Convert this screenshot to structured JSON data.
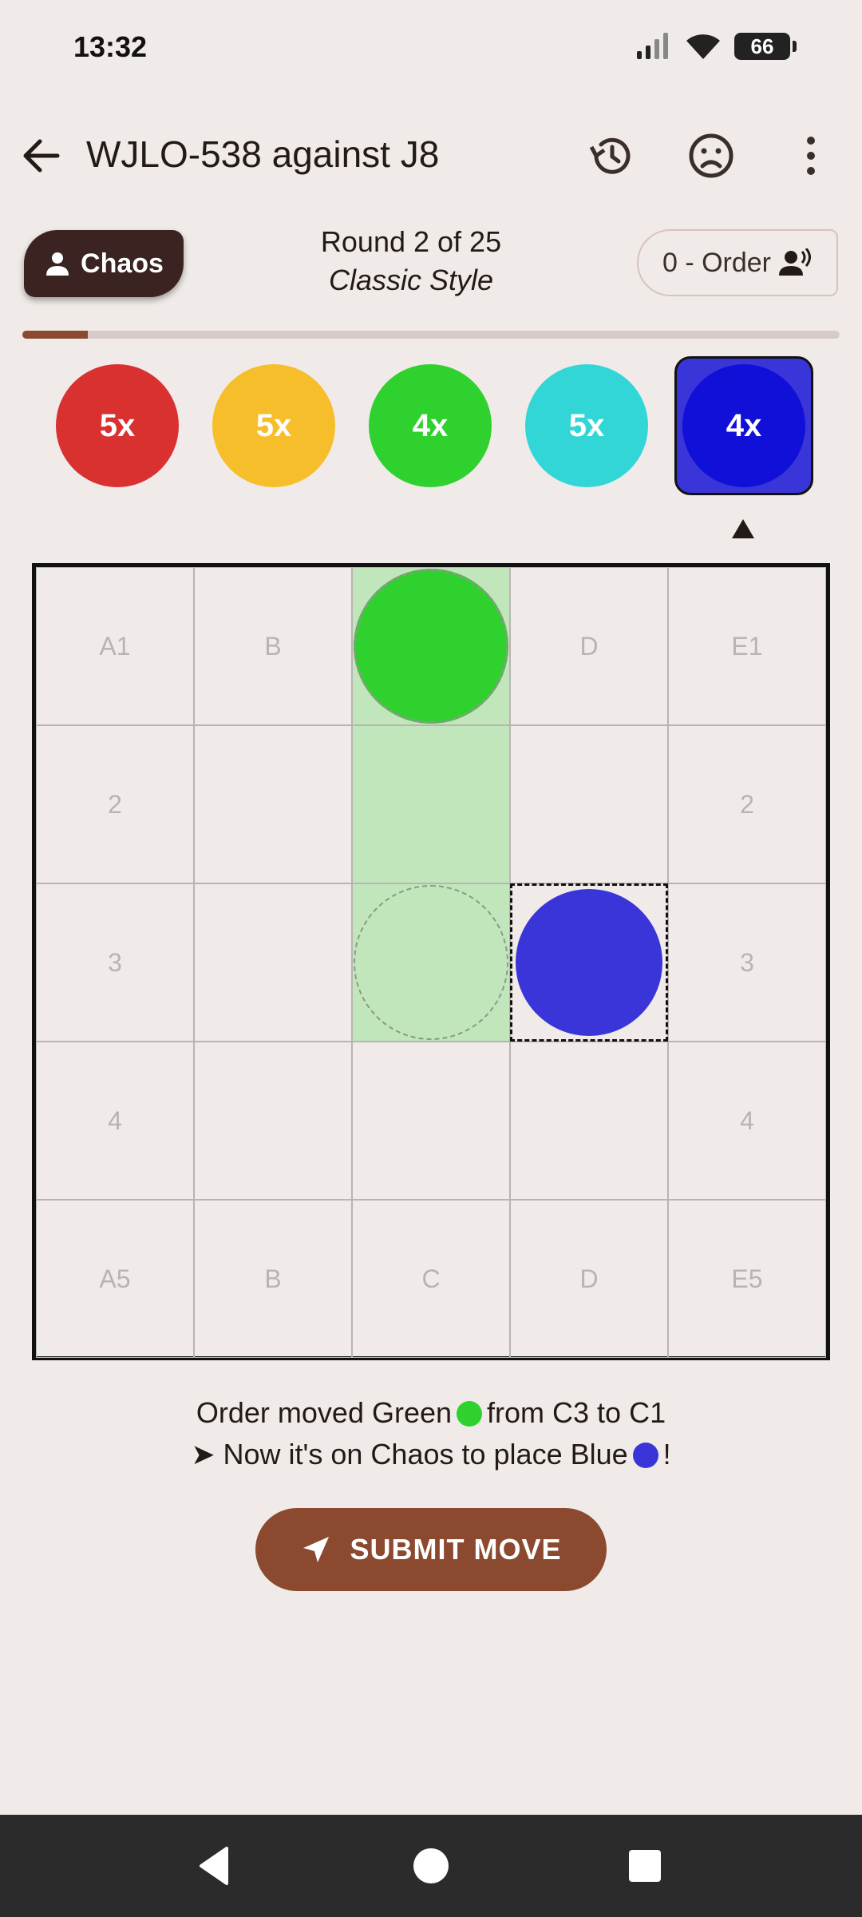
{
  "status_bar": {
    "time": "13:32",
    "battery": "66"
  },
  "app_bar": {
    "title": "WJLO-538 against J8",
    "icons": [
      "back-arrow-icon",
      "history-icon",
      "sad-face-icon",
      "more-vert-icon"
    ]
  },
  "players": {
    "chaos": {
      "label": "Chaos",
      "icon": "person-icon"
    },
    "order": {
      "label": "0 - Order",
      "icon": "person-voice-icon"
    }
  },
  "round": {
    "line": "Round 2 of 25",
    "style": "Classic Style"
  },
  "progress": {
    "fraction": 0.08
  },
  "tokens": [
    {
      "label": "5x",
      "color": "#d93030",
      "selected": false
    },
    {
      "label": "5x",
      "color": "#f7be2c",
      "selected": false
    },
    {
      "label": "4x",
      "color": "#2ed12e",
      "selected": false
    },
    {
      "label": "5x",
      "color": "#33d6d6",
      "selected": false
    },
    {
      "label": "4x",
      "color": "#1010d8",
      "selected": true
    }
  ],
  "board": {
    "rows": [
      [
        "A1",
        "B",
        "",
        "D",
        "E1"
      ],
      [
        "2",
        "",
        "",
        "",
        "2"
      ],
      [
        "3",
        "",
        "",
        "",
        "3"
      ],
      [
        "4",
        "",
        "",
        "",
        "4"
      ],
      [
        "A5",
        "B",
        "C",
        "D",
        "E5"
      ]
    ],
    "highlight_cells": [
      "C1",
      "C2",
      "C3"
    ],
    "pieces": [
      {
        "cell": "C1",
        "color": "#2ed12e",
        "style": "moved"
      },
      {
        "cell": "C3",
        "color": "#c2e6bb",
        "style": "ghost"
      },
      {
        "cell": "D3",
        "color": "#3a35d8",
        "style": "placed"
      }
    ],
    "last_move_cell": "D3"
  },
  "messages": {
    "line1_a": "Order moved Green",
    "line1_b": "from C3 to C1",
    "line2_a": "➤ Now it's on Chaos to place Blue",
    "line2_b": "!"
  },
  "colors": {
    "green": "#2ed12e",
    "blue": "#3a35d8",
    "accent": "#8b4a30"
  },
  "submit": {
    "label": "SUBMIT MOVE",
    "icon": "send-icon"
  },
  "nav": [
    "back-triangle-icon",
    "home-circle-icon",
    "recents-square-icon"
  ]
}
